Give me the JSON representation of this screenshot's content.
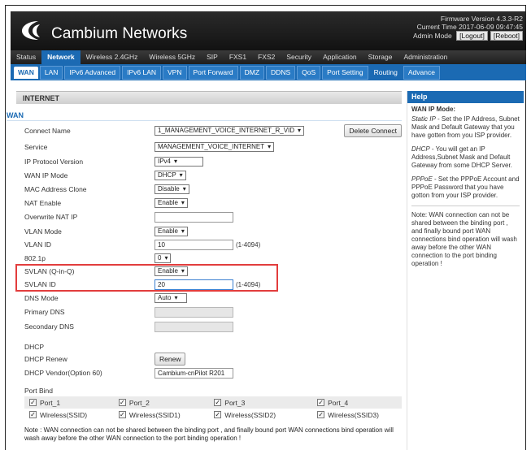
{
  "header": {
    "brand": "Cambium Networks",
    "firmware": "Firmware Version 4.3.3-R2",
    "current_time": "Current Time 2017-06-09 09:47:45",
    "mode": "Admin Mode",
    "logout": "[Logout]",
    "reboot": "[Reboot]"
  },
  "tabs": [
    "Status",
    "Network",
    "Wireless 2.4GHz",
    "Wireless 5GHz",
    "SIP",
    "FXS1",
    "FXS2",
    "Security",
    "Application",
    "Storage",
    "Administration"
  ],
  "subtabs": [
    "WAN",
    "LAN",
    "IPv6 Advanced",
    "IPv6 LAN",
    "VPN",
    "Port Forward",
    "DMZ",
    "DDNS",
    "QoS",
    "Port Setting",
    "Routing",
    "Advance"
  ],
  "section": {
    "title": "INTERNET",
    "group": "WAN"
  },
  "form": {
    "connect_name": {
      "label": "Connect Name",
      "value": "1_MANAGEMENT_VOICE_INTERNET_R_VID",
      "button": "Delete Connect"
    },
    "service": {
      "label": "Service",
      "value": "MANAGEMENT_VOICE_INTERNET"
    },
    "ip_version": {
      "label": "IP Protocol Version",
      "value": "IPv4"
    },
    "wan_ip_mode": {
      "label": "WAN IP Mode",
      "value": "DHCP"
    },
    "mac_clone": {
      "label": "MAC Address Clone",
      "value": "Disable"
    },
    "nat": {
      "label": "NAT Enable",
      "value": "Enable"
    },
    "overwrite_nat": {
      "label": "Overwrite NAT IP",
      "value": ""
    },
    "vlan_mode": {
      "label": "VLAN Mode",
      "value": "Enable"
    },
    "vlan_id": {
      "label": "VLAN ID",
      "value": "10",
      "range": "(1-4094)"
    },
    "dot1p": {
      "label": "802.1p",
      "value": "0"
    },
    "svlan": {
      "label": "SVLAN (Q-in-Q)",
      "value": "Enable"
    },
    "svlan_id": {
      "label": "SVLAN ID",
      "value": "20",
      "range": "(1-4094)"
    },
    "dns_mode": {
      "label": "DNS Mode",
      "value": "Auto"
    },
    "primary_dns": {
      "label": "Primary DNS",
      "value": ""
    },
    "secondary_dns": {
      "label": "Secondary DNS",
      "value": ""
    },
    "dhcp": {
      "label": "DHCP"
    },
    "dhcp_renew": {
      "label": "DHCP Renew",
      "button": "Renew"
    },
    "dhcp_vendor": {
      "label": "DHCP Vendor(Option 60)",
      "value": "Cambium-cnPilot R201"
    }
  },
  "port_bind": {
    "label": "Port Bind",
    "ports": [
      "Port_1",
      "Port_2",
      "Port_3",
      "Port_4"
    ],
    "wireless": [
      "Wireless(SSID)",
      "Wireless(SSID1)",
      "Wireless(SSID2)",
      "Wireless(SSID3)"
    ],
    "note": "Note : WAN connection can not be shared between the binding port , and finally bound port WAN connections bind operation will wash away before the other WAN connection to the port binding operation !"
  },
  "help": {
    "title": "Help",
    "subtitle": "WAN IP Mode:",
    "static_term": "Static IP",
    "static_text": " - Set the IP Address, Subnet Mask and Default Gateway that you have gotten from you ISP provider.",
    "dhcp_term": "DHCP",
    "dhcp_text": " - You will get an IP Address,Subnet Mask and Default Gateway from some DHCP Server.",
    "pppoe_term": "PPPoE",
    "pppoe_text": " - Set the PPPoE Account and PPPoE Password that you have gotton from your ISP provider.",
    "note": "Note: WAN connection can not be shared between the binding port , and finally bound port WAN connections bind operation will wash away before the other WAN connection to the port binding operation !"
  },
  "colors": {
    "accent": "#1b6ab3",
    "highlight": "#e23d3d"
  },
  "icons": {
    "logo": "cambium-logo-icon",
    "checkbox": "checkmark-icon"
  }
}
